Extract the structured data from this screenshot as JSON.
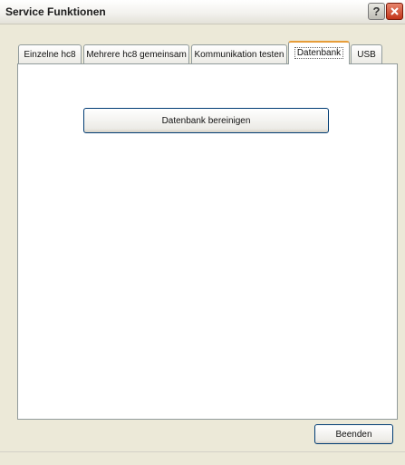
{
  "window": {
    "title": "Service Funktionen",
    "help_symbol": "?"
  },
  "tabs": [
    {
      "label": "Einzelne hc8",
      "active": false
    },
    {
      "label": "Mehrere hc8 gemeinsam",
      "active": false
    },
    {
      "label": "Kommunikation testen",
      "active": false
    },
    {
      "label": "Datenbank",
      "active": true
    },
    {
      "label": "USB",
      "active": false
    }
  ],
  "panel": {
    "clean_button_label": "Datenbank bereinigen"
  },
  "footer": {
    "close_button_label": "Beenden"
  }
}
